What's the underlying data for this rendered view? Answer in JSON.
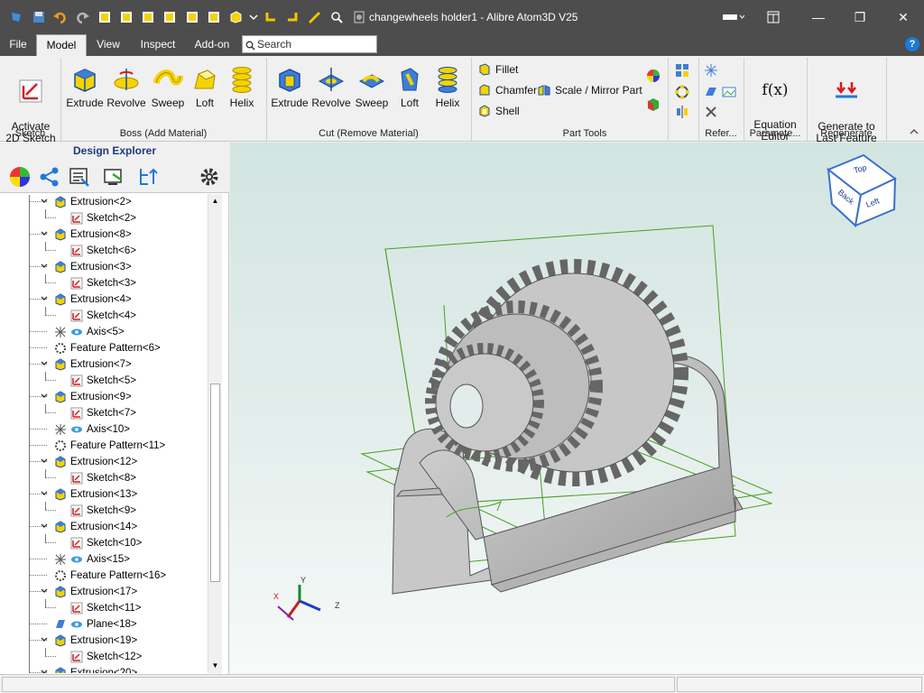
{
  "window": {
    "title": "changewheels holder1 - Alibre Atom3D V25",
    "minimize": "—",
    "restore": "❐",
    "close": "✕"
  },
  "tabs": [
    "File",
    "Model",
    "View",
    "Inspect",
    "Add-on"
  ],
  "search": {
    "placeholder": "Search"
  },
  "help": "?",
  "ribbon": {
    "sketch": {
      "activate_label": "Activate\n2D Sketch",
      "group": "Sketch"
    },
    "boss": {
      "items": [
        "Extrude",
        "Revolve",
        "Sweep",
        "Loft",
        "Helix"
      ],
      "group": "Boss (Add Material)"
    },
    "cut": {
      "items": [
        "Extrude",
        "Revolve",
        "Sweep",
        "Loft",
        "Helix"
      ],
      "group": "Cut (Remove Material)"
    },
    "part_tools": {
      "fillet": "Fillet",
      "chamfer": "Chamfer",
      "scale_mirror": "Scale / Mirror Part",
      "shell": "Shell",
      "group": "Part Tools"
    },
    "reference": {
      "group": "Refer..."
    },
    "parameters": {
      "equation_symbol": "f(x)",
      "equation_label": "Equation\nEditor",
      "group": "Paramete..."
    },
    "regenerate": {
      "label": "Generate to\nLast Feature",
      "group": "Regenerate"
    }
  },
  "design_explorer": {
    "title": "Design Explorer",
    "tree": [
      {
        "label": "Extrusion<2>",
        "type": "extrusion",
        "level": 0
      },
      {
        "label": "Sketch<2>",
        "type": "sketch",
        "level": 1
      },
      {
        "label": "Extrusion<8>",
        "type": "extrusion",
        "level": 0
      },
      {
        "label": "Sketch<6>",
        "type": "sketch",
        "level": 1
      },
      {
        "label": "Extrusion<3>",
        "type": "extrusion",
        "level": 0
      },
      {
        "label": "Sketch<3>",
        "type": "sketch",
        "level": 1
      },
      {
        "label": "Extrusion<4>",
        "type": "extrusion",
        "level": 0
      },
      {
        "label": "Sketch<4>",
        "type": "sketch",
        "level": 1
      },
      {
        "label": "Axis<5>",
        "type": "axis",
        "level": 0
      },
      {
        "label": "Feature Pattern<6>",
        "type": "pattern",
        "level": 0
      },
      {
        "label": "Extrusion<7>",
        "type": "extrusion",
        "level": 0
      },
      {
        "label": "Sketch<5>",
        "type": "sketch",
        "level": 1
      },
      {
        "label": "Extrusion<9>",
        "type": "extrusion",
        "level": 0
      },
      {
        "label": "Sketch<7>",
        "type": "sketch",
        "level": 1
      },
      {
        "label": "Axis<10>",
        "type": "axis",
        "level": 0
      },
      {
        "label": "Feature Pattern<11>",
        "type": "pattern",
        "level": 0
      },
      {
        "label": "Extrusion<12>",
        "type": "extrusion",
        "level": 0
      },
      {
        "label": "Sketch<8>",
        "type": "sketch",
        "level": 1
      },
      {
        "label": "Extrusion<13>",
        "type": "extrusion",
        "level": 0
      },
      {
        "label": "Sketch<9>",
        "type": "sketch",
        "level": 1
      },
      {
        "label": "Extrusion<14>",
        "type": "extrusion",
        "level": 0
      },
      {
        "label": "Sketch<10>",
        "type": "sketch",
        "level": 1
      },
      {
        "label": "Axis<15>",
        "type": "axis",
        "level": 0
      },
      {
        "label": "Feature Pattern<16>",
        "type": "pattern",
        "level": 0
      },
      {
        "label": "Extrusion<17>",
        "type": "extrusion",
        "level": 0
      },
      {
        "label": "Sketch<11>",
        "type": "sketch",
        "level": 1
      },
      {
        "label": "Plane<18>",
        "type": "plane",
        "level": 0
      },
      {
        "label": "Extrusion<19>",
        "type": "extrusion",
        "level": 0
      },
      {
        "label": "Sketch<12>",
        "type": "sketch",
        "level": 1
      },
      {
        "label": "Extrusion<20>",
        "type": "extrusion",
        "level": 0
      }
    ]
  },
  "viewcube": {
    "top": "Top",
    "back": "Back",
    "left": "Left"
  },
  "triad": {
    "x": "X",
    "y": "Y",
    "z": "Z"
  },
  "colors": {
    "accent": "#1e7ad8",
    "titlebar": "#4d4d4d",
    "wireframe": "#4aa020",
    "part": "#bfbfbf"
  }
}
